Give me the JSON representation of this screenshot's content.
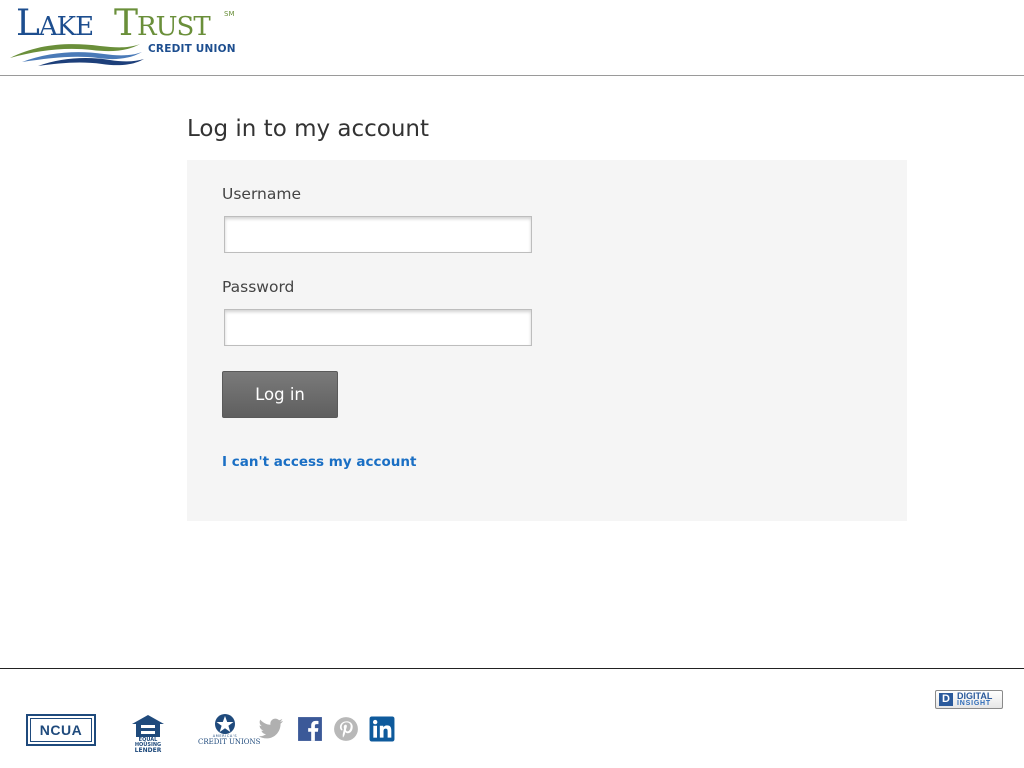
{
  "header": {
    "logo": {
      "lake_first": "L",
      "lake_rest": "AKE",
      "trust_first": "T",
      "trust_rest": "RUST",
      "service_mark": "SM",
      "subtitle": "CREDIT UNION"
    }
  },
  "main": {
    "title": "Log in to my account",
    "username_label": "Username",
    "username_value": "",
    "password_label": "Password",
    "password_value": "",
    "login_button": "Log in",
    "access_link": "I can't access my account"
  },
  "footer": {
    "ncua": "NCUA",
    "equal_housing_line1": "EQUAL HOUSING",
    "equal_housing_line2": "LENDER",
    "acu_small": "AMERICA'S",
    "acu_name": "CREDIT UNIONS",
    "social": [
      "twitter-icon",
      "facebook-icon",
      "pinterest-icon",
      "linkedin-icon"
    ],
    "digital_insight_mark": "D",
    "digital_insight_line1": "DIGITAL",
    "digital_insight_line2": "INSIGHT"
  },
  "colors": {
    "brand_blue": "#1d4e8f",
    "brand_green": "#6a8f3a",
    "link": "#1a6fc4",
    "button": "#6b6b6b",
    "panel": "#f5f5f5"
  }
}
